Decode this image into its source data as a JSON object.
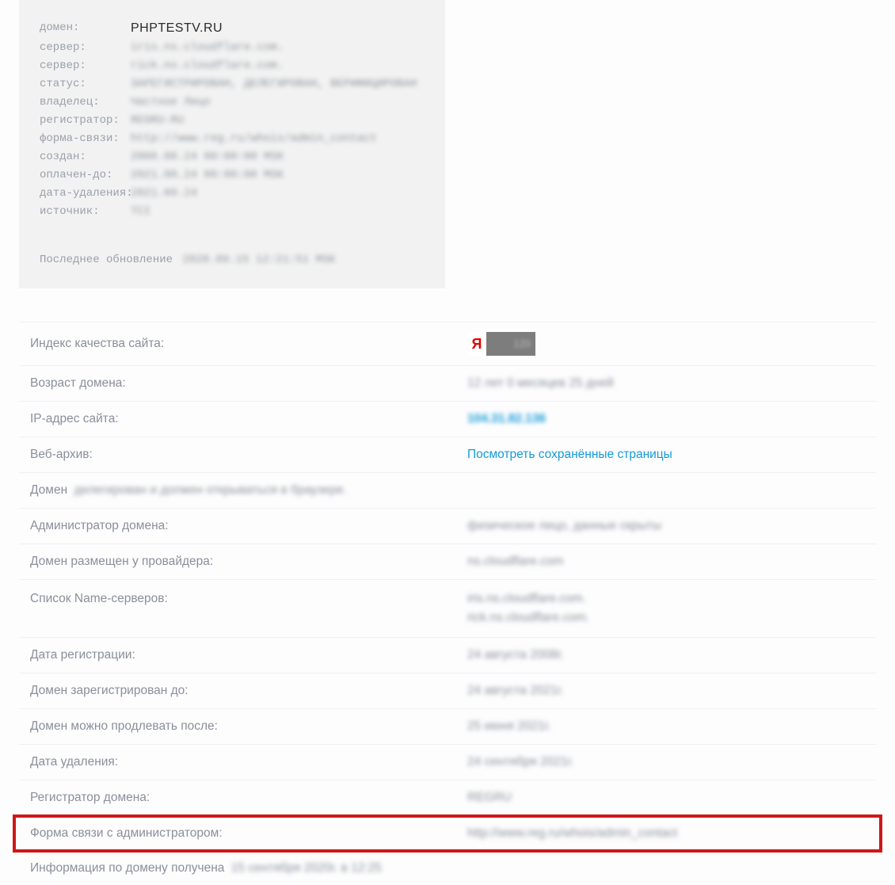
{
  "whois": {
    "labels": {
      "domain": "домен:",
      "server1": "сервер:",
      "server2": "сервер:",
      "status": "статус:",
      "owner": "владелец:",
      "registrar": "регистратор:",
      "contact_form": "форма-связи:",
      "created": "создан:",
      "paid_till": "оплачен-до:",
      "delete_date": "дата-удаления:",
      "source": "источник:"
    },
    "values": {
      "domain": "PHPTESTV.RU",
      "server1": "iris.ns.cloudflare.com.",
      "server2": "rick.ns.cloudflare.com.",
      "status": "ЗАРЕГИСТРИРОВАН, ДЕЛЕГИРОВАН, ВЕРИФИЦИРОВАН",
      "owner": "Частное Лицо",
      "registrar": "REGRU-RU",
      "contact_form": "http://www.reg.ru/whois/admin_contact",
      "created": "2008.08.24 00:00:00 MSK",
      "paid_till": "2021.08.24 00:00:00 MSK",
      "delete_date": "2021.09.24",
      "source": "TCI"
    },
    "footer_label": "Последнее обновление",
    "footer_value": "2020.09.15 12:21:51 MSK"
  },
  "rows": {
    "quality_index_label": "Индекс качества сайта:",
    "badge_letter": "Я",
    "badge_value": "120",
    "age_label": "Возраст домена:",
    "age_value": "12 лет 0 месяцев 25 дней",
    "ip_label": "IP-адрес сайта:",
    "ip_value": "104.31.82.136",
    "webarchive_label": "Веб-архив:",
    "webarchive_link": "Посмотреть сохранённые страницы",
    "domain_status_left": "Домен",
    "domain_status_rest": "делегирован и должен открываться в браузере.",
    "admin_label": "Администратор домена:",
    "admin_value": "физическое лицо, данные скрыты",
    "provider_label": "Домен размещен у провайдера:",
    "provider_value": "ns.cloudflare.com",
    "ns_label": "Список Name-серверов:",
    "ns1": "iris.ns.cloudflare.com.",
    "ns2": "rick.ns.cloudflare.com.",
    "reg_date_label": "Дата регистрации:",
    "reg_date_value": "24 августа 2008г.",
    "reg_until_label": "Домен зарегистрирован до:",
    "reg_until_value": "24 августа 2021г.",
    "renew_after_label": "Домен можно продлевать после:",
    "renew_after_value": "25 июня 2021г.",
    "del_date_label": "Дата удаления:",
    "del_date_value": "24 сентября 2021г.",
    "registrar_label": "Регистратор домена:",
    "registrar_value": "REGRU",
    "contact_form_label": "Форма связи с администратором:",
    "contact_form_value": "http://www.reg.ru/whois/admin_contact",
    "info_prefix": "Информация по домену получена",
    "info_value": "15 сентября 2020г. в 12:25"
  }
}
